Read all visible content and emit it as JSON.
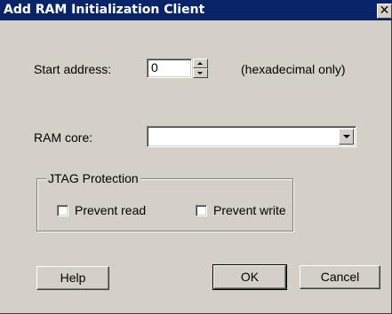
{
  "window": {
    "title": "Add RAM Initialization Client",
    "close_glyph": "✕"
  },
  "start_address": {
    "label": "Start address:",
    "value": "0",
    "hint": "(hexadecimal only)"
  },
  "ram_core": {
    "label": "RAM core:",
    "selected": ""
  },
  "jtag_protection": {
    "legend": "JTAG Protection",
    "prevent_read": {
      "label": "Prevent read",
      "checked": false
    },
    "prevent_write": {
      "label": "Prevent write",
      "checked": false
    }
  },
  "buttons": {
    "help": "Help",
    "ok": "OK",
    "cancel": "Cancel"
  },
  "colors": {
    "titlebar": "#0a246a",
    "dialog_face": "#d4d0c8"
  }
}
